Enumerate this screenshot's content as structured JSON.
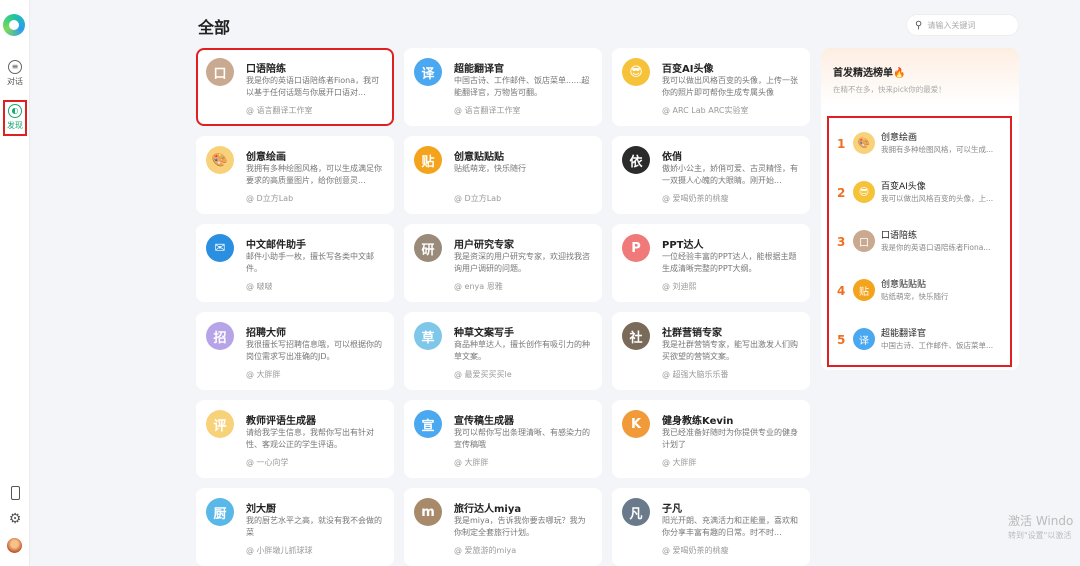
{
  "sidebar": {
    "nav": [
      {
        "label": "对话",
        "icon": "chat-icon"
      },
      {
        "label": "发现",
        "icon": "discover-icon",
        "active": true
      }
    ],
    "bottom_icons": [
      "phone-icon",
      "gear-icon",
      "avatar"
    ]
  },
  "header": {
    "title": "全部",
    "search_placeholder": "请输入关键词"
  },
  "cards": [
    {
      "name": "口语陪练",
      "desc": "我是你的英语口语陪练者Fiona，我可以基于任何话题与你展开口语对...",
      "author": "语言翻译工作室",
      "color": "#c9a98f",
      "glyph": "口",
      "highlight": true
    },
    {
      "name": "超能翻译官",
      "desc": "中国古诗、工作邮件、饭店菜单......超能翻译官，万物皆可翻。",
      "author": "语言翻译工作室",
      "color": "#4aa8f0",
      "glyph": "译"
    },
    {
      "name": "百变AI头像",
      "desc": "我可以做出风格百变的头像，上传一张你的照片即可帮你生成专属头像",
      "author": "ARC Lab ARC实验室",
      "color": "#f6c23a",
      "glyph": "😎"
    },
    {
      "name": "创意绘画",
      "desc": "我拥有多种绘图风格，可以生成满足你要求的高质量图片，给你创意灵...",
      "author": "D立方Lab",
      "color": "#f8d27a",
      "glyph": "🎨"
    },
    {
      "name": "创意贴贴贴",
      "desc": "贴纸萌宠，快乐随行",
      "author": "D立方Lab",
      "color": "#f4a41c",
      "glyph": "贴"
    },
    {
      "name": "依俏",
      "desc": "傲娇小公主，娇俏可爱、古灵精怪，有一双摄人心魄的大眼睛。刚开始...",
      "author": "爱喝奶茶的桃瘦",
      "color": "#2b2b2b",
      "glyph": "依"
    },
    {
      "name": "中文邮件助手",
      "desc": "邮件小助手一枚，擅长写各类中文邮件。",
      "author": "啵啵",
      "color": "#2a8fe0",
      "glyph": "✉"
    },
    {
      "name": "用户研究专家",
      "desc": "我是资深的用户研究专家，欢迎找我咨询用户调研的问题。",
      "author": "enya 恩雅",
      "color": "#9a8a7a",
      "glyph": "研"
    },
    {
      "name": "PPT达人",
      "desc": "一位经验丰富的PPT达人，能根据主题生成清晰完整的PPT大纲。",
      "author": "刘迪熙",
      "color": "#f07a7a",
      "glyph": "P"
    },
    {
      "name": "招聘大师",
      "desc": "我很擅长写招聘信息哦，可以根据你的岗位需求写出准确的JD。",
      "author": "大胖胖",
      "color": "#b7a3e8",
      "glyph": "招"
    },
    {
      "name": "种草文案写手",
      "desc": "商品种草达人，擅长创作有吸引力的种草文案。",
      "author": "最爱买买买le",
      "color": "#7fc7e8",
      "glyph": "草"
    },
    {
      "name": "社群营销专家",
      "desc": "我是社群营销专家，能写出激发人们购买欲望的营销文案。",
      "author": "超强大脑乐乐番",
      "color": "#7a6a5a",
      "glyph": "社"
    },
    {
      "name": "教师评语生成器",
      "desc": "请给我学生信息，我帮你写出有针对性、客观公正的学生评语。",
      "author": "一心向学",
      "color": "#f8d27a",
      "glyph": "评"
    },
    {
      "name": "宣传稿生成器",
      "desc": "我可以帮你写出条理清晰、有感染力的宣传稿哦",
      "author": "大胖胖",
      "color": "#4aa8f0",
      "glyph": "宣"
    },
    {
      "name": "健身教练Kevin",
      "desc": "我已经准备好随时为你提供专业的健身计划了",
      "author": "大胖胖",
      "color": "#f09a3a",
      "glyph": "K"
    },
    {
      "name": "刘大厨",
      "desc": "我的厨艺水平之高，就没有我不会做的菜",
      "author": "小胖墩儿抓球球",
      "color": "#5ab8e8",
      "glyph": "厨"
    },
    {
      "name": "旅行达人miya",
      "desc": "我是miya，告诉我你要去哪玩？我为你制定全套旅行计划。",
      "author": "爱旅游的miya",
      "color": "#a88a6a",
      "glyph": "m"
    },
    {
      "name": "子凡",
      "desc": "阳光开朗、充满活力和正能量，喜欢和你分享丰富有趣的日常。时不时...",
      "author": "爱喝奶茶的桃瘦",
      "color": "#6a7a8a",
      "glyph": "凡"
    }
  ],
  "featured": {
    "title": "首发精选榜单🔥",
    "subtitle": "在精不在多，快来pick你的最爱！",
    "items": [
      {
        "rank": "1",
        "name": "创意绘画",
        "desc": "我拥有多种绘图风格，可以生成...",
        "color": "#f8d27a",
        "glyph": "🎨"
      },
      {
        "rank": "2",
        "name": "百变AI头像",
        "desc": "我可以做出风格百变的头像，上...",
        "color": "#f6c23a",
        "glyph": "😎"
      },
      {
        "rank": "3",
        "name": "口语陪练",
        "desc": "我是你的英语口语陪练者Fiona...",
        "color": "#c9a98f",
        "glyph": "口"
      },
      {
        "rank": "4",
        "name": "创意贴贴贴",
        "desc": "贴纸萌宠，快乐随行",
        "color": "#f4a41c",
        "glyph": "贴"
      },
      {
        "rank": "5",
        "name": "超能翻译官",
        "desc": "中国古诗、工作邮件、饭店菜单...",
        "color": "#4aa8f0",
        "glyph": "译"
      }
    ]
  },
  "watermark": {
    "line1": "激活 Windo",
    "line2": "转到\"设置\"以激活"
  }
}
